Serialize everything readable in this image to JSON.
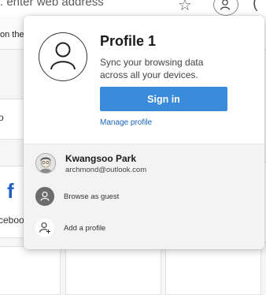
{
  "browser": {
    "address_placeholder": ". enter web address",
    "favorites_text": "on the",
    "left_snippet_1": "o",
    "left_snippet_2": "ceboo"
  },
  "popup": {
    "profile_name": "Profile 1",
    "description": "Sync your browsing data across all your devices.",
    "signin_label": "Sign in",
    "manage_label": "Manage profile",
    "accounts": [
      {
        "name": "Kwangsoo Park",
        "email": "archmond@outlook.com"
      }
    ],
    "guest_label": "Browse as guest",
    "add_label": "Add a profile"
  },
  "colors": {
    "accent": "#3a8bd9",
    "link": "#1a63b8"
  }
}
